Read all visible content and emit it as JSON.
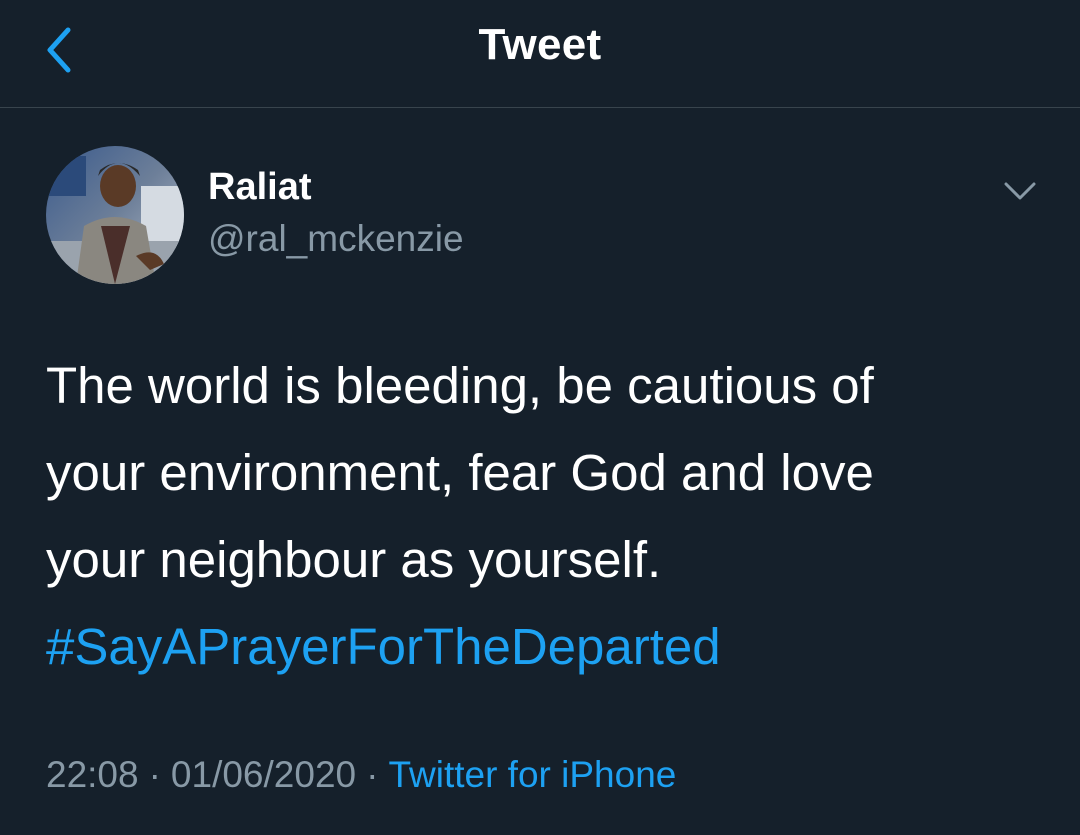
{
  "header": {
    "title": "Tweet",
    "back_icon": "chevron-left-icon"
  },
  "tweet": {
    "author_name": "Raliat",
    "author_handle": "@ral_mckenzie",
    "menu_icon": "chevron-down-icon",
    "text_lines": [
      "The world is bleeding, be cautious of",
      "your environment, fear God and love",
      "your neighbour as yourself."
    ],
    "hashtag": "#SayAPrayerForTheDeparted",
    "time": "22:08",
    "date": "01/06/2020",
    "separator": "·",
    "source": "Twitter for iPhone"
  },
  "colors": {
    "background": "#15202b",
    "accent": "#1da1f2",
    "secondary_text": "#8899a6",
    "divider": "#38444d"
  }
}
